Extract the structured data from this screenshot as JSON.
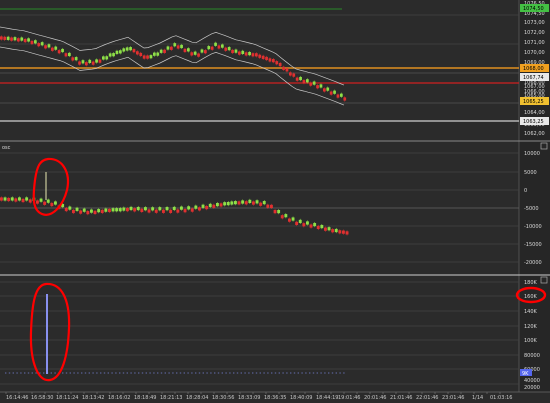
{
  "panels": [
    {
      "name": "price",
      "axis_labels": [
        "1076,50",
        "1074,50",
        "1073,00",
        "1072,00",
        "1071,00",
        "1070,00",
        "1069,00",
        "1068,00",
        "1067,00",
        "1066,00",
        "1065,00",
        "1064,00",
        "1063,00",
        "1062,00"
      ],
      "tags": [
        {
          "text": "1074,50",
          "bg": "#44c044",
          "fg": "#000000"
        },
        {
          "text": "1068,00",
          "bg": "#f0a020",
          "fg": "#000000"
        },
        {
          "text": "1067,74",
          "bg": "#e8e8e8",
          "fg": "#000000"
        },
        {
          "text": "1065,25",
          "bg": "#f0c030",
          "fg": "#000000"
        },
        {
          "text": "1063,25",
          "bg": "#e8e8e8",
          "fg": "#000000"
        }
      ]
    },
    {
      "name": "oscillator",
      "title": "osc",
      "axis_labels": [
        "10000",
        "5000",
        "0",
        "-5000",
        "-10000",
        "-15000",
        "-20000"
      ]
    },
    {
      "name": "volume",
      "axis_labels": [
        "180K",
        "160K",
        "140K",
        "120K",
        "100K",
        "80000",
        "60000",
        "40000",
        "20000",
        "0"
      ],
      "tag": {
        "text": "9K",
        "bg": "#5566ee",
        "fg": "#ffffff"
      },
      "circled_label": "160K"
    }
  ],
  "x_axis_labels": [
    "16:14:46",
    "16:58:30",
    "18:11:24",
    "18:13:42",
    "18:16:02",
    "18:18:49",
    "18:21:13",
    "18:28:04",
    "18:30:56",
    "18:33:09",
    "18:36:35",
    "18:40:09",
    "18:44:19",
    "19:01:46",
    "20:01:46",
    "21:01:46",
    "22:01:46",
    "23:01:46",
    "1/14",
    "01:03:16"
  ],
  "colors": {
    "background": "#2b2b2b",
    "up_candle": "#8ee048",
    "down_candle": "#e03030",
    "support_line": "#e09020",
    "resistance_line": "#d02020",
    "top_line": "#2a8a2a",
    "annotation": "#ff0000",
    "volume_spike": "#8890ee"
  },
  "icons": [
    "panel-collapse-icon"
  ]
}
